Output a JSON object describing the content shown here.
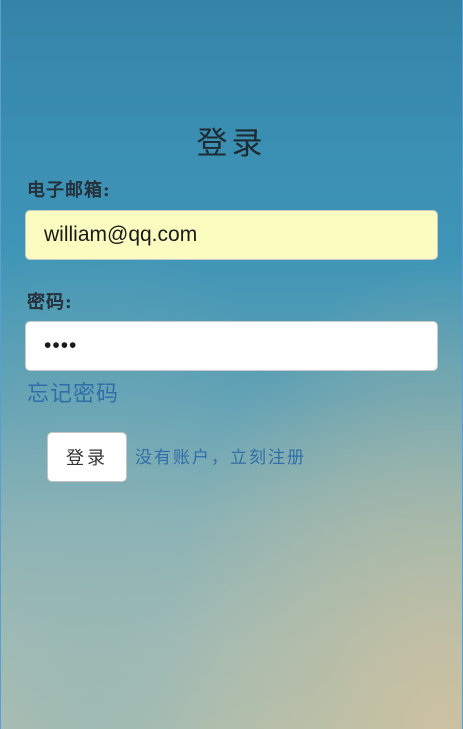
{
  "page": {
    "title": "登录"
  },
  "form": {
    "email_label": "电子邮箱:",
    "email_value": "william@qq.com",
    "password_label": "密码:",
    "password_value": "1234",
    "forgot_password_link": "忘记密码",
    "submit_label": "登录",
    "register_link": "没有账户，立刻注册"
  },
  "colors": {
    "autofill_background": "#fafcc0",
    "link": "#2f6ea8",
    "background_top": "#3584a8",
    "background_bottom": "#b9c2b0"
  }
}
